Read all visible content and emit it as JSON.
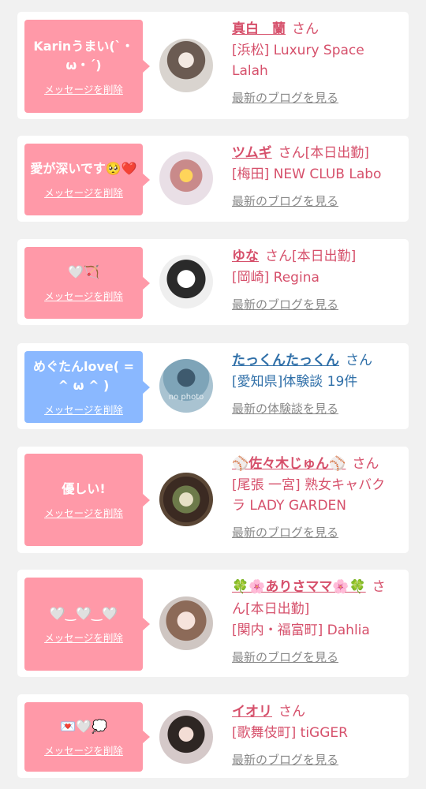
{
  "items": [
    {
      "message": "Karinうまい(`・ω・´)",
      "delete": "メッセージを削除",
      "name": "真白　蘭",
      "honorific": "さん",
      "shop": "[浜松] Luxury Space Lalah",
      "link": "最新のブログを見る"
    },
    {
      "message": "愛が深いです🥺❤️",
      "delete": "メッセージを削除",
      "name": "ツムギ",
      "honorific": "さん[本日出勤]",
      "shop": "[梅田] NEW CLUB Labo",
      "link": "最新のブログを見る"
    },
    {
      "message": "🤍🏹",
      "delete": "メッセージを削除",
      "name": "ゆな",
      "honorific": "さん[本日出勤]",
      "shop": "[岡崎] Regina",
      "link": "最新のブログを見る"
    },
    {
      "message": "めぐたんlove( = ^ ω ^ )",
      "delete": "メッセージを削除",
      "name": "たっくんたっくん",
      "honorific": "さん",
      "shop": "[愛知県]体験談 19件",
      "link": "最新の体験談を見る",
      "avatar_text": "no photo"
    },
    {
      "message": "優しい!",
      "delete": "メッセージを削除",
      "name": "⚾佐々木じゅん⚾",
      "honorific": "さん",
      "shop": "[尾張 一宮] 熟女キャバクラ LADY GARDEN",
      "link": "最新のブログを見る"
    },
    {
      "message": "🤍‿🤍‿🤍",
      "delete": "メッセージを削除",
      "name": "🍀🌸ありさママ🌸🍀",
      "honorific": "さん[本日出勤]",
      "shop": "[関内・福富町] Dahlia",
      "link": "最新のブログを見る"
    },
    {
      "message": "💌🤍💭",
      "delete": "メッセージを削除",
      "name": "イオリ",
      "honorific": "さん",
      "shop": "[歌舞伎町] tiGGER",
      "link": "最新のブログを見る"
    }
  ],
  "colors": {
    "pink_bubble": "#ff99a8",
    "blue_bubble": "#8ab8ff",
    "pink_text": "#d6506b",
    "blue_text": "#2f6fa8"
  }
}
